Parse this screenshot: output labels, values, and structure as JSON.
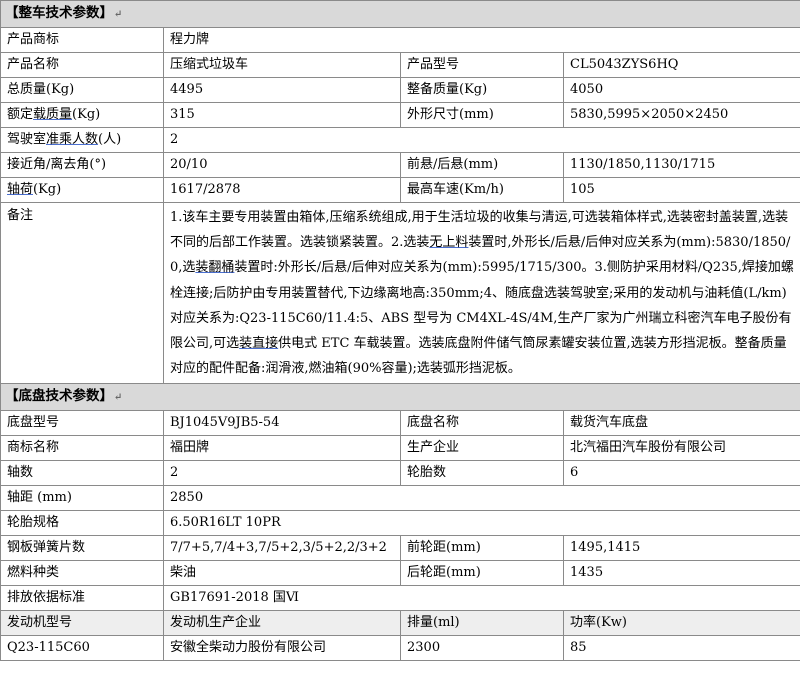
{
  "vehicle_section": {
    "title": "【整车技术参数】"
  },
  "vehicle": {
    "brand_label": "产品商标",
    "brand": "程力牌",
    "name_label": "产品名称",
    "name": "压缩式垃圾车",
    "model_label": "产品型号",
    "model": "CL5043ZYS6HQ",
    "total_mass_label": "总质量(Kg)",
    "total_mass": "4495",
    "curb_mass_label": "整备质量(Kg)",
    "curb_mass": "4050",
    "rated_load_label_a": "额定",
    "rated_load_label_b": "载质量",
    "rated_load_label_c": "(Kg)",
    "rated_load": "315",
    "dimensions_label": "外形尺寸(mm)",
    "dimensions": "5830,5995×2050×2450",
    "cab_seats_label_a": "驾驶室",
    "cab_seats_label_b": "准乘人数",
    "cab_seats_label_c": "(人)",
    "cab_seats": "2",
    "angles_label": "接近角/离去角(°)",
    "angles": "20/10",
    "overhang_label": "前悬/后悬(mm)",
    "overhang": "1130/1850,1130/1715",
    "axle_load_label_a": "轴荷",
    "axle_load_label_b": "(Kg)",
    "axle_load": "1617/2878",
    "max_speed_label": "最高车速(Km/h)",
    "max_speed": "105",
    "remark_label": "备注",
    "remark": {
      "p1": "1.该车主要专用装置由箱体,压缩系统组成,用于生活垃圾的收集与清运,可选装箱体样式,选装密封盖装置,选装不同的后部工作装置。选装锁紧装置。2.选装",
      "u1": "无上料",
      "p2": "装置时,外形长/后悬/后伸对应关系为(mm):5830/1850/0,选",
      "u2": "装翻桶",
      "p3": "装置时:外形长/后悬/后伸对应关系为(mm):5995/1715/300。3.侧防护采用材料/Q235,焊接加螺栓连接;后防护由专用装置替代,下边缘离地高:350mm;4、随底盘选装驾驶室;采用的发动机与油耗值(L/km)对应关系为:Q23-115C60/11.4:5、ABS 型号为 CM4XL-4S/4M,生产厂家为广州瑞立科密汽车电子股份有限公司,可选",
      "u3": "装直接",
      "p4": "供电式 ETC 车载装置。选装底盘附件储气筒尿素罐安装位置,选装方形挡泥板。整备质量对应的配件配备:润滑液,燃油箱(90%容量);选装弧形挡泥板。"
    }
  },
  "chassis_section": {
    "title": "【底盘技术参数】"
  },
  "chassis": {
    "model_label": "底盘型号",
    "model": "BJ1045V9JB5-54",
    "name_label": "底盘名称",
    "name": "载货汽车底盘",
    "brand_label": "商标名称",
    "brand": "福田牌",
    "maker_label": "生产企业",
    "maker": "北汽福田汽车股份有限公司",
    "axles_label": "轴数",
    "axles": "2",
    "tires_count_label": "轮胎数",
    "tires_count": "6",
    "wheelbase_label": "轴距 (mm)",
    "wheelbase": "2850",
    "tire_spec_label": "轮胎规格",
    "tire_spec": "6.50R16LT 10PR",
    "springs_label": "钢板弹簧片数",
    "springs": "7/7+5,7/4+3,7/5+2,3/5+2,2/3+2",
    "front_track_label": "前轮距(mm)",
    "front_track": "1495,1415",
    "fuel_label": "燃料种类",
    "fuel": "柴油",
    "rear_track_label": "后轮距(mm)",
    "rear_track": "1435",
    "emission_label": "排放依据标准",
    "emission": "GB17691-2018 国Ⅵ"
  },
  "engine": {
    "headers": [
      "发动机型号",
      "发动机生产企业",
      "排量(ml)",
      "功率(Kw)"
    ],
    "row": [
      "Q23-115C60",
      "安徽全柴动力股份有限公司",
      "2300",
      "85"
    ]
  }
}
